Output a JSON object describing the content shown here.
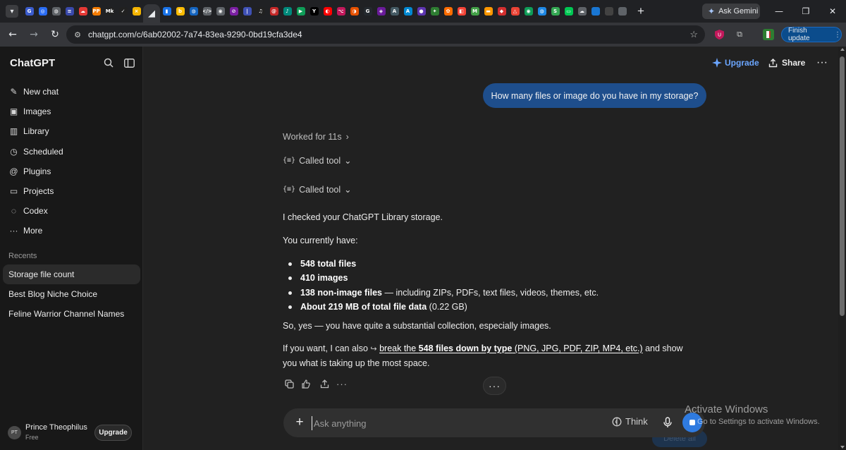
{
  "browser": {
    "tab_colors": [
      "#3b5ccc",
      "#2a6df4",
      "#5f6368",
      "#3949ab",
      "#e53935",
      "#f57c00",
      "#212121",
      "#212121",
      "#f4b400",
      "#35363a",
      "#1a73e8",
      "#fbbc04",
      "#1565c0",
      "#5f6368",
      "#5f6368",
      "#7b1fa2",
      "#3f51b5",
      "#212121",
      "#c62828",
      "#00897b",
      "#0f9d58",
      "#000000",
      "#ff0000",
      "#c2185b",
      "#e65100",
      "#24292e",
      "#6a1b9a",
      "#455a64",
      "#0288d1",
      "#5e35b1",
      "#2e7d32",
      "#ff6d00",
      "#f44336",
      "#43a047",
      "#ff9800",
      "#d32f2f",
      "#ea4335",
      "#0f9d58",
      "#1e88e5",
      "#34a853",
      "#00c853",
      "#5f6368",
      "#1976d2",
      "#424242",
      "#5f6368"
    ],
    "tab_glyphs": [
      "G",
      "◎",
      "◍",
      "≡",
      "☁",
      "PP",
      "Mk",
      "✓",
      "×",
      "◢",
      "▮",
      "b",
      "◍",
      "</>",
      "◉",
      "⊘",
      "|",
      "♫",
      "@",
      "♪",
      "▶",
      "Y",
      "◐",
      "⌥",
      "◑",
      "G",
      "◈",
      "A",
      "A",
      "●",
      "✦",
      "✿",
      "◧",
      "M",
      "▬",
      "◆",
      "△",
      "◉",
      "◍",
      "S",
      "▭",
      "☁"
    ],
    "new_tab_label": "+",
    "ask_gemini_label": "Ask Gemini",
    "window_controls": {
      "minimize": "—",
      "restore": "❐",
      "close": "✕"
    },
    "back_icon": "←",
    "forward_icon": "→",
    "reload_icon": "↻",
    "url": "chatgpt.com/c/6ab02002-7a74-83ea-9290-0bd19cfa3de4",
    "bookmark_icon": "☆",
    "finish_update_label": "Finish update",
    "finish_update_menu": "⋮"
  },
  "sidebar": {
    "brand": "ChatGPT",
    "nav": [
      {
        "label": "New chat",
        "icon": "✎"
      },
      {
        "label": "Images",
        "icon": "▣"
      },
      {
        "label": "Library",
        "icon": "▥"
      },
      {
        "label": "Scheduled",
        "icon": "◷"
      },
      {
        "label": "Plugins",
        "icon": "@"
      },
      {
        "label": "Projects",
        "icon": "▭"
      },
      {
        "label": "Codex",
        "icon": "◌"
      },
      {
        "label": "More",
        "icon": "···"
      }
    ],
    "recents_label": "Recents",
    "recents": [
      "Storage file count",
      "Best Blog Niche Choice",
      "Feline Warrior Channel Names"
    ],
    "profile": {
      "initials": "PT",
      "name": "Prince Theophilus",
      "plan": "Free",
      "upgrade_label": "Upgrade"
    }
  },
  "header": {
    "upgrade_label": "Upgrade",
    "share_label": "Share",
    "more_icon": "···"
  },
  "conversation": {
    "user_message": "How many files or image do you have in my storage?",
    "worked_for": "Worked for 11s",
    "called_tool_1": "Called tool",
    "called_tool_2": "Called tool",
    "braces_icon": "{≡}",
    "para1": "I checked your ChatGPT Library storage.",
    "para2": "You currently have:",
    "bullets": [
      {
        "bold": "548 total files",
        "rest": ""
      },
      {
        "bold": "410 images",
        "rest": ""
      },
      {
        "bold": "138 non-image files",
        "rest": " — including ZIPs, PDFs, text files, videos, themes, etc."
      },
      {
        "bold": "About 219 MB of total file data",
        "rest": " (0.22 GB)"
      }
    ],
    "para3": "So, yes — you have quite a substantial collection, especially images.",
    "para4_prefix": "If you want, I can also ",
    "para4_arrow": "↪",
    "para4_link_pre": "break the ",
    "para4_link_bold": "548 files down by type",
    "para4_link_post": " (PNG, JPG, PDF, ZIP, MP4, etc.)",
    "para4_suffix": " and show you what is taking up the most space.",
    "more_pill": "···"
  },
  "composer": {
    "plus_icon": "+",
    "placeholder": "Ask anything",
    "think_label": "Think",
    "mic_icon": "🎙"
  },
  "background": {
    "ghost_button": "Delete all"
  },
  "watermark": {
    "title": "Activate Windows",
    "subtitle": "Go to Settings to activate Windows."
  }
}
